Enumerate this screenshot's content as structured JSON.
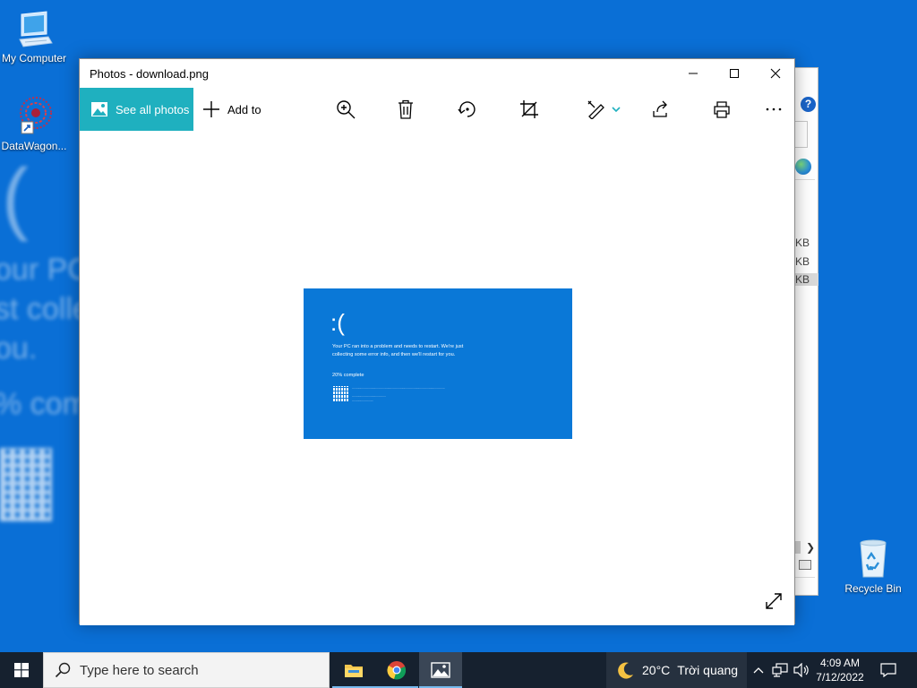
{
  "desktop": {
    "icons": {
      "my_computer": "My Computer",
      "datawagon": "DataWagon...",
      "recycle_bin": "Recycle Bin"
    }
  },
  "background_window": {
    "kb_rows": [
      "KB",
      "KB",
      "KB"
    ],
    "help_glyph": "?"
  },
  "photos_window": {
    "title": "Photos - download.png",
    "toolbar": {
      "see_all_photos": "See all photos",
      "add_to": "Add to"
    },
    "image": {
      "face": ":(",
      "message": "Your PC ran into a problem and needs to restart. We're just collecting some error info, and then we'll restart for you.",
      "progress": "20% complete"
    }
  },
  "taskbar": {
    "search_placeholder": "Type here to search",
    "weather": {
      "temp": "20°C",
      "condition": "Trời quang"
    },
    "clock": {
      "time": "4:09 AM",
      "date": "7/12/2022"
    }
  },
  "colors": {
    "desktop_bg": "#0a6fd6",
    "accent_teal": "#1fb0bf",
    "bsod_blue": "#0a78d7",
    "taskbar_bg": "#16212f"
  }
}
